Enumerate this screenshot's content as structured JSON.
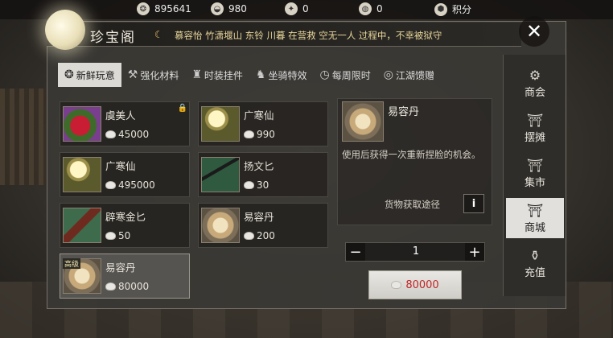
{
  "currencies": [
    {
      "icon": "silver-ingot-icon",
      "glyph": "❂",
      "value": "895641"
    },
    {
      "icon": "coin-stack-icon",
      "glyph": "◒",
      "value": "980"
    },
    {
      "icon": "ticket-icon",
      "glyph": "✦",
      "value": "0"
    },
    {
      "icon": "gold-ingot-icon",
      "glyph": "◍",
      "value": "0"
    },
    {
      "icon": "points-badge-icon",
      "glyph": "⬢",
      "value": "积分"
    }
  ],
  "shop": {
    "title": "珍宝阁",
    "close_glyph": "✕",
    "announcement": "慕容怡 竹潇堰山 东铃 川暮 在营救 空无一人 过程中，不幸被狱守"
  },
  "tabs": [
    {
      "label": "新鲜玩意",
      "glyph": "❂"
    },
    {
      "label": "强化材料",
      "glyph": "⚒"
    },
    {
      "label": "时装挂件",
      "glyph": "♜"
    },
    {
      "label": "坐骑特效",
      "glyph": "♞"
    },
    {
      "label": "每周限时",
      "glyph": "◷"
    },
    {
      "label": "江湖馈赠",
      "glyph": "◎"
    }
  ],
  "items": [
    {
      "name": "虞美人",
      "price": "45000",
      "thumb": "flower",
      "locked": true
    },
    {
      "name": "广寒仙",
      "price": "990",
      "thumb": "moon"
    },
    {
      "name": "广寒仙",
      "price": "495000",
      "thumb": "moon"
    },
    {
      "name": "扬文匕",
      "price": "30",
      "thumb": "sword"
    },
    {
      "name": "辟寒金匕",
      "price": "50",
      "thumb": "blade"
    },
    {
      "name": "易容丹",
      "price": "200",
      "thumb": "pill"
    },
    {
      "name": "易容丹",
      "price": "80000",
      "thumb": "pill",
      "tag": "高级",
      "selected": true
    }
  ],
  "detail": {
    "name": "易容丹",
    "description": "使用后获得一次重新捏脸的机会。",
    "source_label": "货物获取途径",
    "info_glyph": "i",
    "quantity": "1",
    "minus": "−",
    "plus": "+",
    "total_price": "80000"
  },
  "sidebar": [
    {
      "label": "商会",
      "glyph": "⚙"
    },
    {
      "label": "摆摊",
      "glyph": "⛩"
    },
    {
      "label": "集市",
      "glyph": "⛩"
    },
    {
      "label": "商城",
      "glyph": "⛩",
      "active": true
    },
    {
      "label": "充值",
      "glyph": "⚱"
    }
  ]
}
